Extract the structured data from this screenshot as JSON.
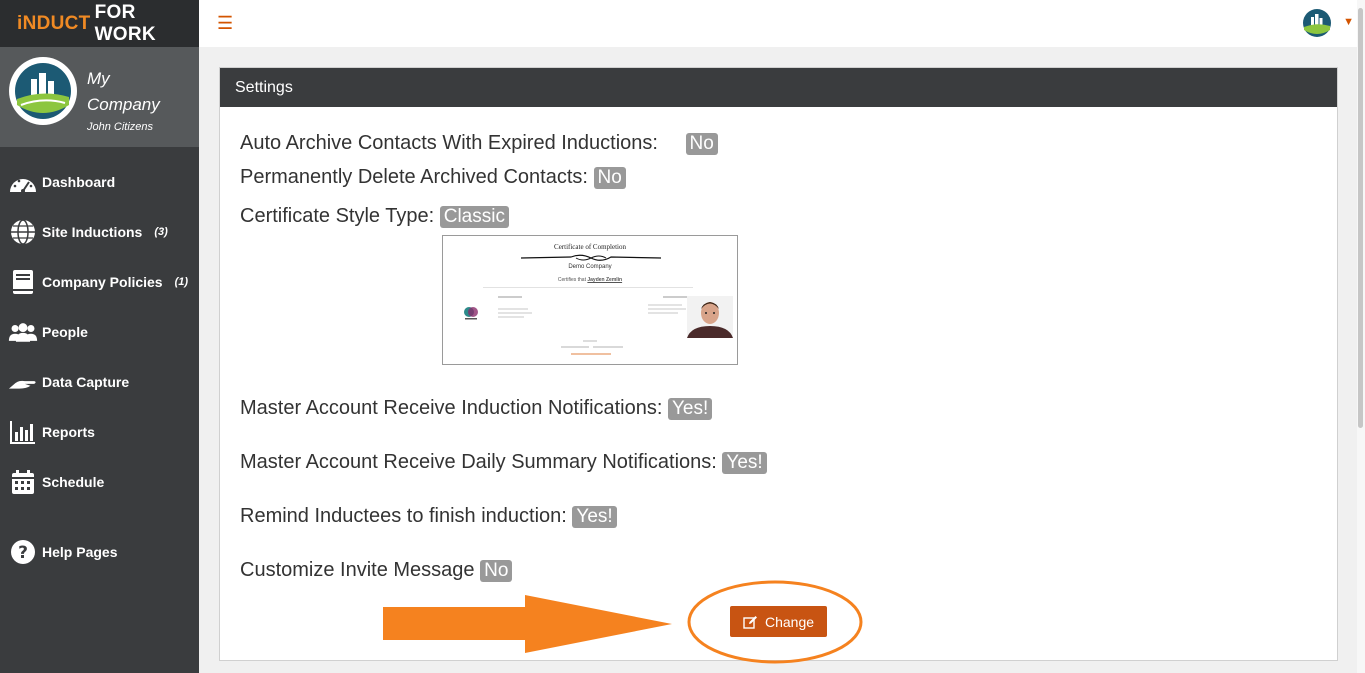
{
  "brand": {
    "part1": "iNDUCT",
    "part2": "FOR WORK"
  },
  "profile": {
    "company": "My Company",
    "user": "John Citizens"
  },
  "nav": [
    {
      "label": "Dashboard",
      "count": "",
      "icon": "dashboard-gauge-icon"
    },
    {
      "label": "Site Inductions",
      "count": "(3)",
      "icon": "globe-icon"
    },
    {
      "label": "Company Policies",
      "count": "(1)",
      "icon": "book-icon"
    },
    {
      "label": "People",
      "count": "",
      "icon": "people-icon"
    },
    {
      "label": "Data Capture",
      "count": "",
      "icon": "hand-icon"
    },
    {
      "label": "Reports",
      "count": "",
      "icon": "bar-chart-icon"
    },
    {
      "label": "Schedule",
      "count": "",
      "icon": "calendar-icon"
    },
    {
      "label": "Help Pages",
      "count": "",
      "icon": "question-circle-icon"
    }
  ],
  "settings": {
    "title": "Settings",
    "auto_archive": {
      "label": "Auto Archive Contacts With Expired Inductions:",
      "value": "No"
    },
    "perm_delete": {
      "label": "Permanently Delete Archived Contacts:",
      "value": "No"
    },
    "cert_style": {
      "label": "Certificate Style Type:",
      "value": "Classic"
    },
    "induction_notif": {
      "label": "Master Account Receive Induction Notifications:",
      "value": "Yes!"
    },
    "daily_summary": {
      "label": "Master Account Receive Daily Summary Notifications:",
      "value": "Yes!"
    },
    "remind": {
      "label": "Remind Inductees to finish induction:",
      "value": "Yes!"
    },
    "invite_msg": {
      "label": "Customize Invite Message",
      "value": "No"
    },
    "change_label": "Change"
  },
  "certificate": {
    "heading": "Certificate of Completion",
    "company": "Demo Company",
    "certifies": "Certifies that",
    "person": "Jayden Zemlin"
  },
  "colors": {
    "accent": "#c85412",
    "sidebar": "#3a3c3e",
    "badge": "#999999",
    "annotation": "#f5821f"
  }
}
